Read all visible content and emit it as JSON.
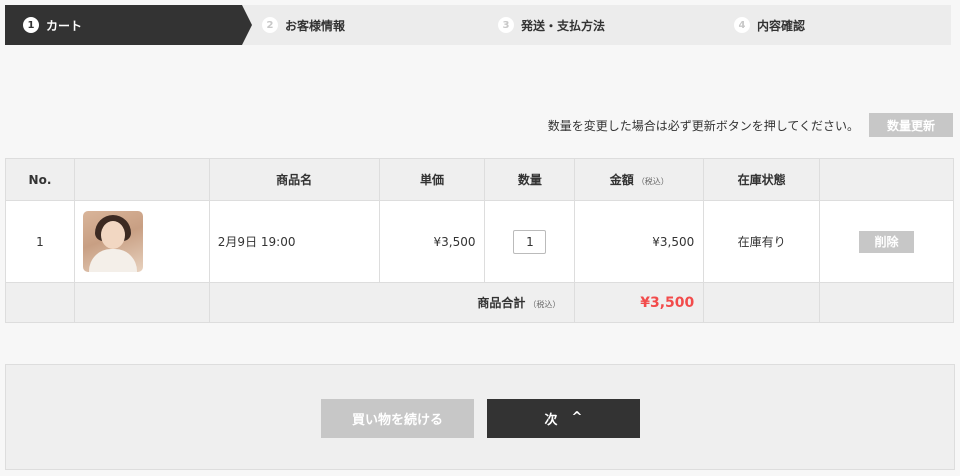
{
  "steps": [
    {
      "num": "1",
      "label": "カート",
      "active": true
    },
    {
      "num": "2",
      "label": "お客様情報",
      "active": false
    },
    {
      "num": "3",
      "label": "発送・支払方法",
      "active": false
    },
    {
      "num": "4",
      "label": "内容確認",
      "active": false
    }
  ],
  "notice": {
    "text": "数量を変更した場合は必ず更新ボタンを押してください。",
    "update_button": "数量更新"
  },
  "table": {
    "headers": {
      "no": "No.",
      "image": "",
      "name": "商品名",
      "unit_price": "単価",
      "quantity": "数量",
      "amount": "金額",
      "amount_note": "（税込）",
      "stock": "在庫状態",
      "actions": ""
    },
    "rows": [
      {
        "no": "1",
        "image_icon": "product-photo-woman",
        "name": "2月9日 19:00",
        "unit_price": "¥3,500",
        "quantity": "1",
        "amount": "¥3,500",
        "stock": "在庫有り",
        "delete_label": "削除"
      }
    ],
    "total": {
      "label": "商品合計",
      "note": "（税込）",
      "value": "¥3,500"
    }
  },
  "actions": {
    "continue_label": "買い物を続ける",
    "next_label": "次",
    "next_icon": "chevron-up-icon"
  },
  "colors": {
    "active_step": "#333333",
    "total_price": "#f24b4b",
    "disabled_button": "#c7c7c7"
  }
}
